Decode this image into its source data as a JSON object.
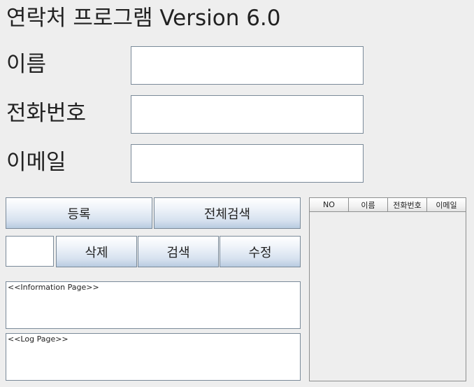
{
  "window": {
    "title": "연락처 프로그램 Version 6.0"
  },
  "form": {
    "name_label": "이름",
    "name_value": "",
    "phone_label": "전화번호",
    "phone_value": "",
    "email_label": "이메일",
    "email_value": ""
  },
  "buttons": {
    "register": "등록",
    "search_all": "전체검색",
    "delete": "삭제",
    "search": "검색",
    "edit": "수정"
  },
  "id_field": {
    "value": ""
  },
  "info_page": {
    "caption": "<<Information Page>>"
  },
  "log_page": {
    "caption": "<<Log Page>>"
  },
  "table": {
    "columns": [
      "NO",
      "이름",
      "전화번호",
      "이메일"
    ],
    "rows": []
  }
}
